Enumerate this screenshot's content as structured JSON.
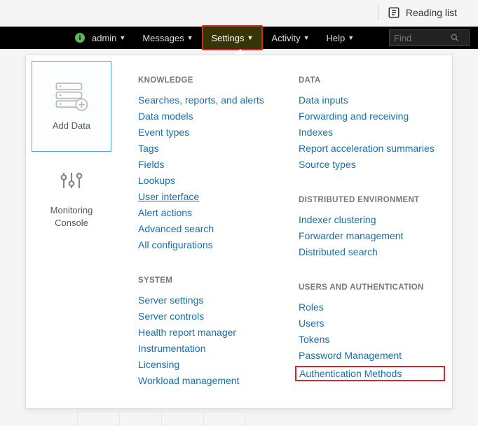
{
  "topbar": {
    "reading_list": "Reading list"
  },
  "nav": {
    "admin": "admin",
    "messages": "Messages",
    "settings": "Settings",
    "activity": "Activity",
    "help": "Help",
    "search_placeholder": "Find"
  },
  "cards": {
    "add_data": "Add Data",
    "monitoring_console_1": "Monitoring",
    "monitoring_console_2": "Console"
  },
  "sections": {
    "knowledge": "KNOWLEDGE",
    "system": "SYSTEM",
    "data": "DATA",
    "dist_env": "DISTRIBUTED ENVIRONMENT",
    "users_auth": "USERS AND AUTHENTICATION"
  },
  "knowledge": {
    "searches": "Searches, reports, and alerts",
    "data_models": "Data models",
    "event_types": "Event types",
    "tags": "Tags",
    "fields": "Fields",
    "lookups": "Lookups",
    "user_interface": "User interface",
    "alert_actions": "Alert actions",
    "advanced_search": "Advanced search",
    "all_config": "All configurations"
  },
  "system": {
    "server_settings": "Server settings",
    "server_controls": "Server controls",
    "health_report": "Health report manager",
    "instrumentation": "Instrumentation",
    "licensing": "Licensing",
    "workload": "Workload management"
  },
  "data": {
    "data_inputs": "Data inputs",
    "fwd_recv": "Forwarding and receiving",
    "indexes": "Indexes",
    "report_accel": "Report acceleration summaries",
    "source_types": "Source types"
  },
  "dist": {
    "indexer_clustering": "Indexer clustering",
    "fwd_mgmt": "Forwarder management",
    "dist_search": "Distributed search"
  },
  "users": {
    "roles": "Roles",
    "users": "Users",
    "tokens": "Tokens",
    "pwd_mgmt": "Password Management",
    "auth_methods": "Authentication Methods"
  }
}
